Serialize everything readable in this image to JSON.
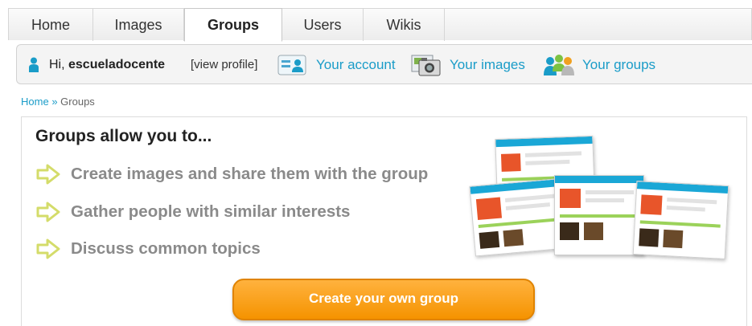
{
  "tabs": [
    {
      "label": "Home",
      "active": false
    },
    {
      "label": "Images",
      "active": false
    },
    {
      "label": "Groups",
      "active": true
    },
    {
      "label": "Users",
      "active": false
    },
    {
      "label": "Wikis",
      "active": false
    }
  ],
  "userbar": {
    "greeting": "Hi, ",
    "username": "escueladocente",
    "view_profile": "[view profile]",
    "links": [
      {
        "label": "Your account",
        "icon": "account-card-icon"
      },
      {
        "label": "Your images",
        "icon": "camera-icon"
      },
      {
        "label": "Your groups",
        "icon": "people-icon"
      }
    ]
  },
  "breadcrumb": {
    "home": "Home",
    "separator": "»",
    "current": "Groups"
  },
  "panel": {
    "title": "Groups allow you to...",
    "features": [
      "Create images and share them with the group",
      "Gather people with similar interests",
      "Discuss common topics"
    ],
    "cta_label": "Create your own group"
  },
  "colors": {
    "link": "#1a9cc8",
    "cta": "#f59300",
    "feature_text": "#8a8a8a",
    "arrow": "#d4dc6a"
  }
}
